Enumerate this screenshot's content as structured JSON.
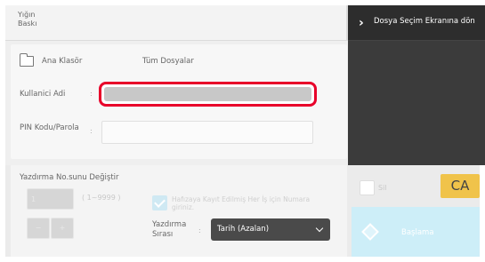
{
  "mode": {
    "line1": "Yığın",
    "line2": "Baskı"
  },
  "folder": {
    "label": "Ana Klasör",
    "value": "Tüm Dosyalar"
  },
  "user": {
    "label": "Kullanici Adi",
    "colon": ":"
  },
  "pin": {
    "label": "PIN Kodu/Parola",
    "colon": ":"
  },
  "back": {
    "label": "Dosya Seçim Ekranına dön"
  },
  "print_no": {
    "title": "Yazdırma No.sunu Değiştir",
    "stepper_value": "1",
    "range": "( 1~9999 )",
    "minus": "−",
    "plus": "+"
  },
  "remember": {
    "text": "Hafızaya Kayıt Edilmiş Her İş için Numara giriniz."
  },
  "sort": {
    "label_line1": "Yazdırma",
    "label_line2": "Sırası",
    "colon": ":",
    "value": "Tarih (Azalan)"
  },
  "delete": {
    "label": "Sil"
  },
  "ca": {
    "label": "CA"
  },
  "start": {
    "label": "Başlama"
  }
}
